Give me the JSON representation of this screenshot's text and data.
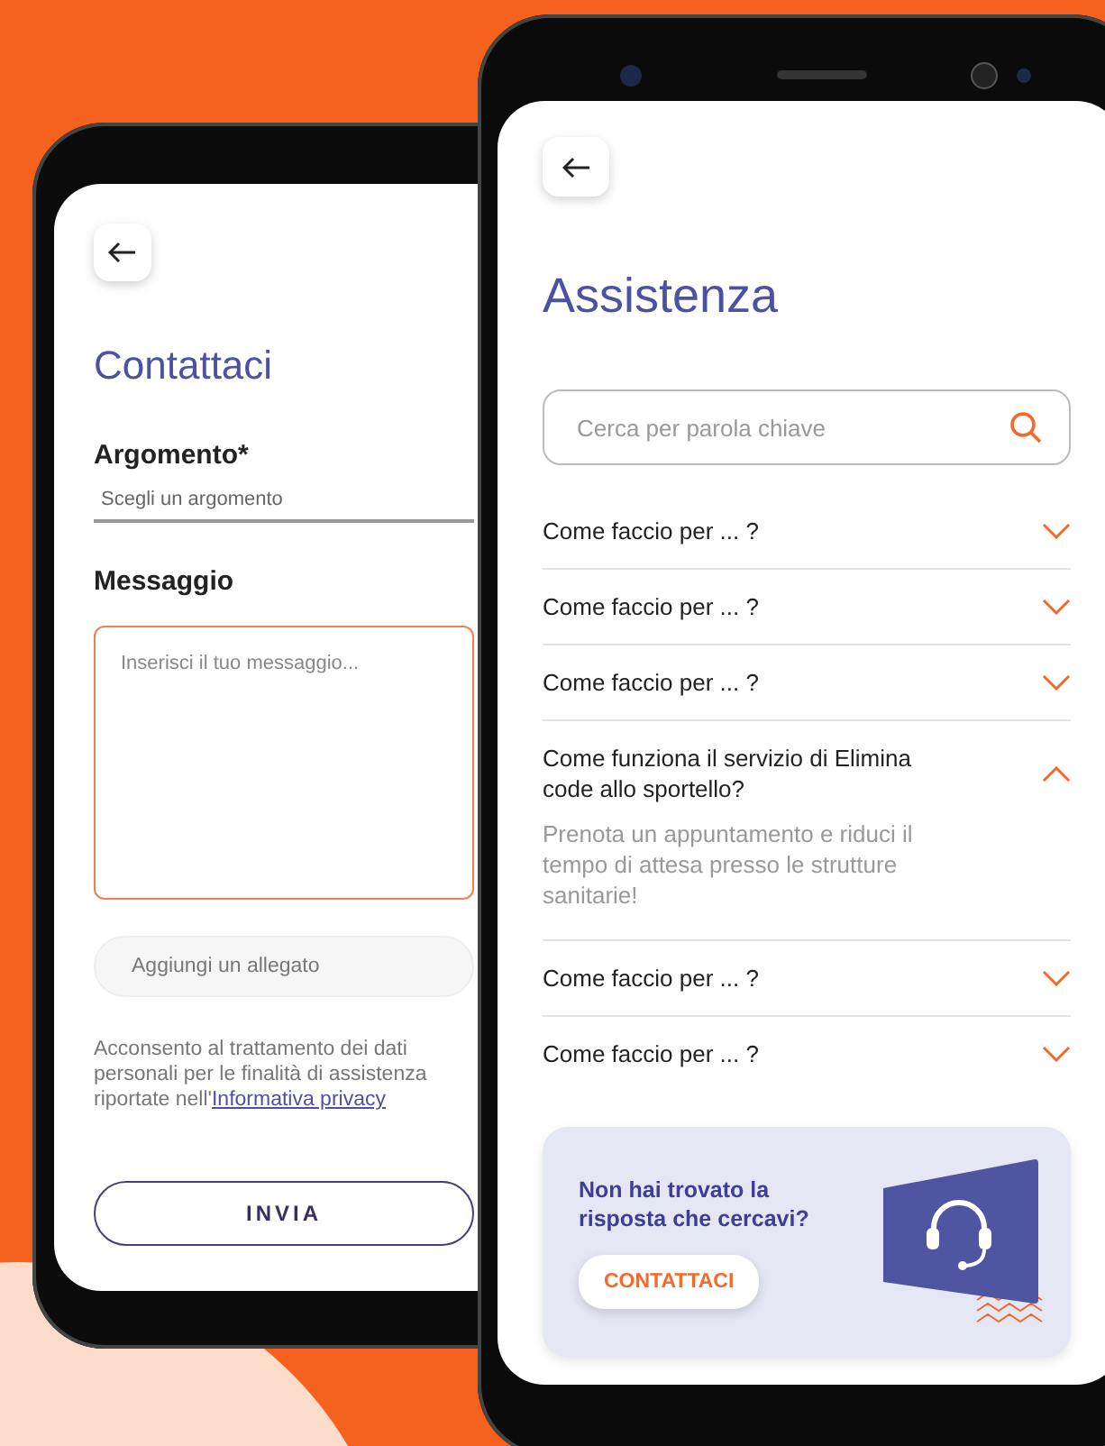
{
  "contact_screen": {
    "title": "Contattaci",
    "topic": {
      "label": "Argomento*",
      "placeholder": "Scegli un argomento"
    },
    "message": {
      "label": "Messaggio",
      "placeholder": "Inserisci il tuo messaggio..."
    },
    "attachment": {
      "placeholder": "Aggiungi un allegato"
    },
    "consent": {
      "text": "Acconsento al trattamento dei dati personali per le finalità di assistenza riportate nell'",
      "link": "Informativa privacy"
    },
    "submit": "INVIA"
  },
  "help_screen": {
    "title": "Assistenza",
    "search": {
      "placeholder": "Cerca per parola chiave"
    },
    "faq": [
      {
        "question": "Come faccio per ... ?",
        "expanded": false
      },
      {
        "question": "Come faccio per ... ?",
        "expanded": false
      },
      {
        "question": "Come faccio per ... ?",
        "expanded": false
      },
      {
        "question": "Come funziona il servizio di Elimina code allo sportello?",
        "expanded": true,
        "answer": "Prenota un appuntamento e riduci il tempo di attesa presso le strutture sanitarie!"
      },
      {
        "question": "Come faccio per ... ?",
        "expanded": false
      },
      {
        "question": "Come faccio per ... ?",
        "expanded": false
      }
    ],
    "banner": {
      "text": "Non hai trovato la risposta che cercavi?",
      "button": "CONTATTACI"
    }
  }
}
